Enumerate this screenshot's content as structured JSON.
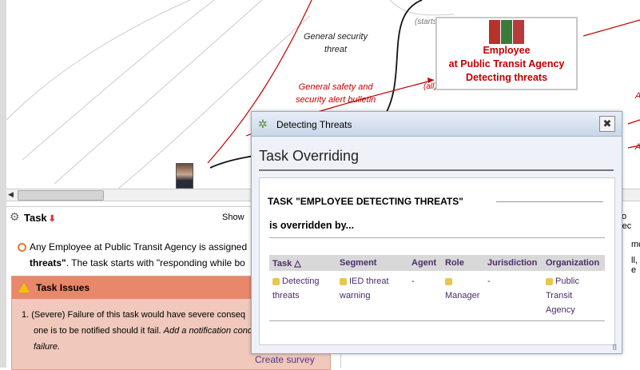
{
  "graph": {
    "edge_labels": [
      {
        "line1": "General security",
        "line2": "threat"
      },
      {
        "line1": "General safety and",
        "line2": "security alert bulletin"
      }
    ],
    "annotations": [
      "(starts)",
      "(all)"
    ],
    "node": {
      "line1": "Employee",
      "line2": "at Public Transit Agency",
      "line3": "Detecting threats"
    },
    "right_markers": [
      "A",
      "A",
      "A"
    ]
  },
  "task_panel": {
    "title": "Task",
    "show_label": "Show",
    "description_line1": "Any Employee at Public Transit Agency is assigned",
    "description_bold": "threats\"",
    "description_rest": ". The task starts with \"responding while bo",
    "issues_title": "Task Issues",
    "issue_prefix": "1.",
    "issue_line1": "(Severe) Failure of this task would have severe conseq",
    "issue_line2_plain": "one is to be notified should it fail.",
    "issue_line2_italic": "Add a notification condi",
    "issue_line3_italic": "failure.",
    "create_survey": "Create survey"
  },
  "right_panel": {
    "frag1": "fo rec",
    "frag2": "mo",
    "frag3": "ll, e"
  },
  "dialog": {
    "title": "Detecting Threats",
    "heading": "Task Overriding",
    "section_title": "TASK \"EMPLOYEE DETECTING THREATS\"",
    "subtitle": "is overridden by...",
    "columns": [
      "Task △",
      "Segment",
      "Agent",
      "Role",
      "Jurisdiction",
      "Organization"
    ],
    "row": {
      "task": "Detecting threats",
      "segment": "IED threat warning",
      "agent": "-",
      "role": "Manager",
      "jurisdiction": "-",
      "organization": "Public Transit Agency"
    }
  },
  "colors": {
    "accent_red": "#c00000",
    "issues_header": "#e8876a",
    "link_purple": "#4a2d6a"
  }
}
